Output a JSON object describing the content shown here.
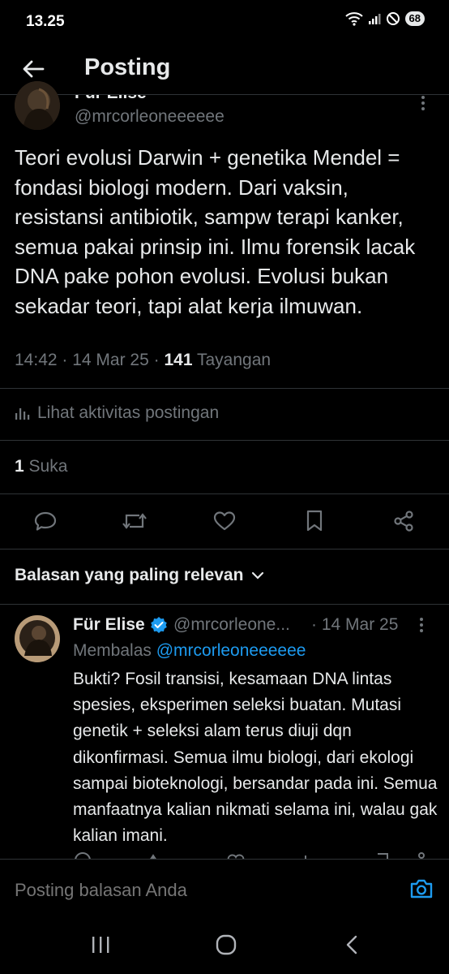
{
  "status_bar": {
    "time": "13.25",
    "battery": "68"
  },
  "header": {
    "title": "Posting"
  },
  "post": {
    "author_name": "Für Elise",
    "handle": "@mrcorleoneeeeee",
    "text": "Teori evolusi Darwin + genetika Mendel = fondasi biologi modern. Dari vaksin, resistansi antibiotik, sampw terapi kanker, semua pakai prinsip ini. Ilmu forensik lacak DNA pake pohon evolusi. Evolusi bukan sekadar teori, tapi alat kerja ilmuwan.",
    "time": "14:42",
    "date": "14 Mar 25",
    "views_count": "141",
    "views_label": "Tayangan",
    "activity_label": "Lihat aktivitas postingan",
    "likes_count": "1",
    "likes_label": "Suka"
  },
  "replies_sort": {
    "label": "Balasan yang paling relevan"
  },
  "reply": {
    "author_name": "Für Elise",
    "handle": "@mrcorleone...",
    "date": "· 14 Mar 25",
    "replying_label": "Membalas",
    "replying_to": "@mrcorleoneeeeee",
    "text": "Bukti? Fosil transisi, kesamaan DNA lintas spesies, eksperimen seleksi buatan. Mutasi genetik + seleksi alam terus diuji dqn dikonfirmasi. Semua ilmu biologi, dari ekologi sampai bioteknologi, bersandar pada ini. Semua manfaatnya kalian nikmati selama ini, walau gak kalian imani."
  },
  "composer": {
    "placeholder": "Posting balasan Anda"
  },
  "colors": {
    "background": "#000000",
    "text": "#e7e9ea",
    "muted": "#71767b",
    "accent": "#1d9bf0",
    "divider": "#2f3336"
  },
  "icons": {
    "back": "arrow-left-icon",
    "verified": "verified-badge-icon",
    "more": "more-vertical-icon",
    "activity": "bar-chart-icon",
    "reply": "reply-icon",
    "repost": "repost-icon",
    "like": "heart-icon",
    "bookmark": "bookmark-icon",
    "share": "share-icon",
    "sort": "chevron-down-icon",
    "camera": "camera-icon"
  }
}
